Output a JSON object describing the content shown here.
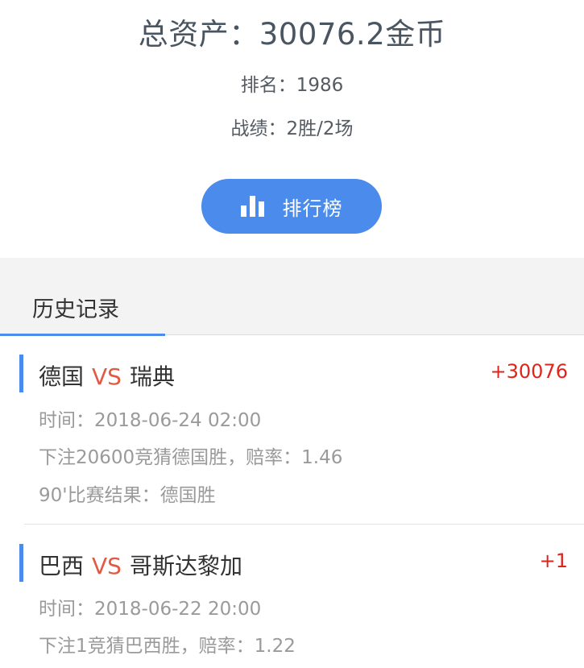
{
  "summary": {
    "total": "总资产：30076.2金币",
    "rank": "排名：1986",
    "record": "战绩：2胜/2场",
    "ranking_button_label": "排行榜",
    "ranking_icon": "bar-chart-icon"
  },
  "history": {
    "tab_label": "历史记录",
    "records": [
      {
        "team_a": "德国",
        "vs": "VS",
        "team_b": "瑞典",
        "profit": "+30076",
        "time": "时间：2018-06-24 02:00",
        "bet": "下注20600竞猜德国胜，赔率：1.46",
        "result": "90'比赛结果：德国胜"
      },
      {
        "team_a": "巴西",
        "vs": "VS",
        "team_b": "哥斯达黎加",
        "profit": "+1",
        "time": "时间：2018-06-22 20:00",
        "bet": "下注1竞猜巴西胜，赔率：1.22"
      }
    ]
  },
  "colors": {
    "accent": "#4a8bec",
    "vs": "#e05a44",
    "profit": "#e0241b",
    "muted_text": "#9a9a9a"
  }
}
